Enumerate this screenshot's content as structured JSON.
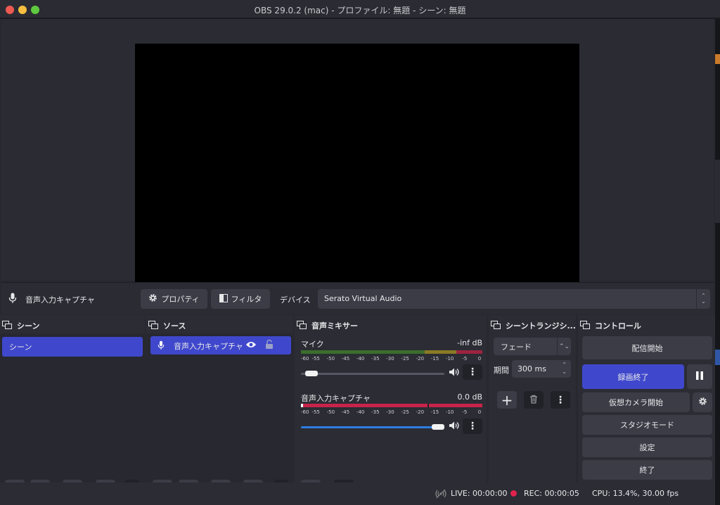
{
  "window": {
    "title": "OBS 29.0.2 (mac) - プロファイル: 無題 - シーン: 無題"
  },
  "source_toolbar": {
    "source_name": "音声入力キャプチャ",
    "properties_label": "プロパティ",
    "filters_label": "フィルタ",
    "device_label": "デバイス",
    "device_value": "Serato Virtual Audio"
  },
  "scenes": {
    "title": "シーン",
    "items": [
      "シーン"
    ]
  },
  "sources": {
    "title": "ソース",
    "items": [
      "音声入力キャプチャ"
    ]
  },
  "mixer": {
    "title": "音声ミキサー",
    "channels": [
      {
        "name": "マイク",
        "db": "-inf dB",
        "volume": 0.03
      },
      {
        "name": "音声入力キャプチャ",
        "db": "0.0 dB",
        "volume": 1.0
      }
    ],
    "ticks": [
      "-60",
      "-55",
      "-50",
      "-45",
      "-40",
      "-35",
      "-30",
      "-25",
      "-20",
      "-15",
      "-10",
      "-5",
      "0"
    ]
  },
  "transitions": {
    "title": "シーントランジシ...",
    "type": "フェード",
    "duration_label": "期間",
    "duration_value": "300 ms"
  },
  "controls": {
    "title": "コントロール",
    "start_streaming": "配信開始",
    "stop_recording": "録画終了",
    "start_virtualcam": "仮想カメラ開始",
    "studio_mode": "スタジオモード",
    "settings": "設定",
    "exit": "終了"
  },
  "status": {
    "live": "LIVE: 00:00:00",
    "rec": "REC: 00:00:05",
    "cpu": "CPU: 13.4%, 30.00 fps"
  },
  "colors": {
    "accent": "#3f48cc",
    "meter_green": "#4a9e3a",
    "meter_yellow": "#b59b2c",
    "meter_red": "#c8234a",
    "rec_dot": "#e0234e",
    "slider_blue": "#2f7de0"
  }
}
